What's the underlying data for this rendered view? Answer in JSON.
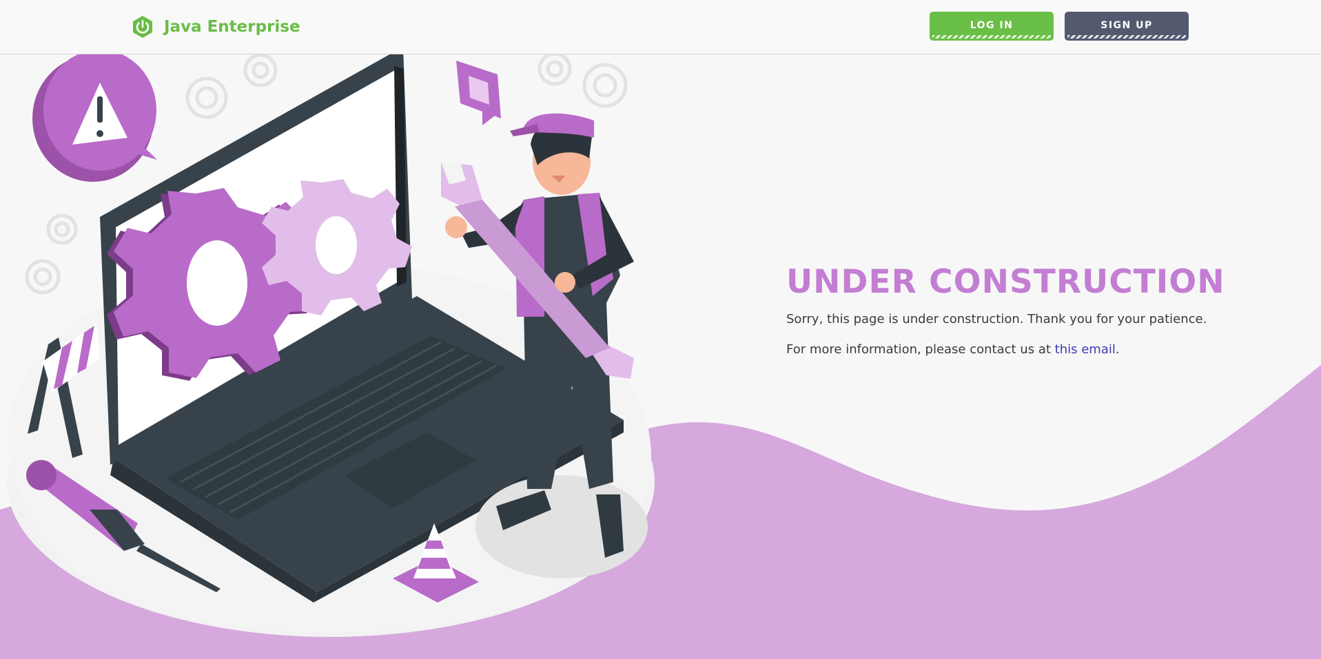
{
  "header": {
    "brand_name": "Java Enterprise",
    "login_label": "LOG IN",
    "signup_label": "SIGN UP"
  },
  "main": {
    "title": "UNDER CONSTRUCTION",
    "paragraph_1": "Sorry, this page is under construction. Thank you for your patience.",
    "paragraph_2_prefix": "For more information, please contact us at ",
    "email_link_text": "this email",
    "paragraph_2_suffix": "."
  },
  "icons": {
    "brand_logo": "power-icon",
    "illustration": "under-construction-illustration"
  },
  "colors": {
    "brand_green": "#6abd45",
    "login_button": "#6abf46",
    "signup_button": "#535a70",
    "title_purple": "#c37ed3",
    "wave_purple": "#d6a8de",
    "link_blue": "#3c3cb4"
  }
}
